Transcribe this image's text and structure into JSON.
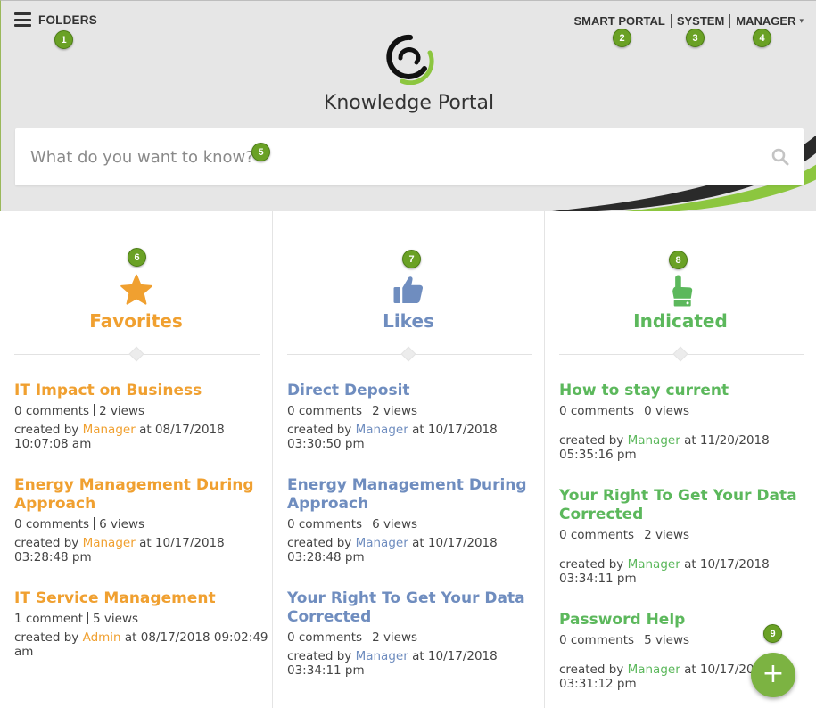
{
  "header": {
    "folders_label": "FOLDERS",
    "nav": [
      "SMART PORTAL",
      "SYSTEM",
      "MANAGER"
    ],
    "manager_caret": "▾",
    "title": "Knowledge Portal"
  },
  "search": {
    "placeholder": "What do you want to know?",
    "icon": "search-icon"
  },
  "badges": [
    "1",
    "2",
    "3",
    "4",
    "5",
    "6",
    "7",
    "8",
    "9"
  ],
  "colors": {
    "favorites": "#f0a030",
    "likes": "#6f8dbf",
    "indicated": "#5cb85c",
    "badge": "#6aa125",
    "fab": "#7cb342"
  },
  "favorites": {
    "title": "Favorites",
    "icon": "star-icon",
    "articles": [
      {
        "title": "IT Impact on Business",
        "comments": "0 comments",
        "views": "2 views",
        "created_prefix": "created by",
        "user": "Manager",
        "date_line1": "at 08/17/2018",
        "date_line2": "10:07:08 am"
      },
      {
        "title_line1": "Energy Management During",
        "title_line2": "Approach",
        "comments": "0 comments",
        "views": "6 views",
        "created_prefix": "created by",
        "user": "Manager",
        "date_line1": "at 10/17/2018",
        "date_line2": "03:28:48 pm"
      },
      {
        "title": "IT Service Management",
        "comments": "1 comment",
        "views": "5 views",
        "created_prefix": "created by",
        "user": "Admin",
        "date_line1": "at 08/17/2018 09:02:49",
        "date_line2": "am"
      }
    ]
  },
  "likes": {
    "title": "Likes",
    "icon": "thumbs-up-icon",
    "articles": [
      {
        "title": "Direct Deposit",
        "comments": "0 comments",
        "views": "2 views",
        "created_prefix": "created by",
        "user": "Manager",
        "date_line1": "at 10/17/2018",
        "date_line2": "03:30:50 pm"
      },
      {
        "title_line1": "Energy Management During",
        "title_line2": "Approach",
        "comments": "0 comments",
        "views": "6 views",
        "created_prefix": "created by",
        "user": "Manager",
        "date_line1": "at 10/17/2018",
        "date_line2": "03:28:48 pm"
      },
      {
        "title_line1": "Your Right To Get Your Data",
        "title_line2": "Corrected",
        "comments": "0 comments",
        "views": "2 views",
        "created_prefix": "created by",
        "user": "Manager",
        "date_line1": "at 10/17/2018",
        "date_line2": "03:34:11 pm"
      }
    ]
  },
  "indicated": {
    "title": "Indicated",
    "icon": "pointing-hand-icon",
    "articles": [
      {
        "title": "How to stay current",
        "comments": "0 comments",
        "views": "0 views",
        "created_prefix": "created by",
        "user": "Manager",
        "date_line1": "at 11/20/2018",
        "date_line2": "05:35:16 pm"
      },
      {
        "title_line1": "Your Right To Get Your Data",
        "title_line2": "Corrected",
        "comments": "0 comments",
        "views": "2 views",
        "created_prefix": "created by",
        "user": "Manager",
        "date_line1": "at 10/17/2018",
        "date_line2": "03:34:11 pm"
      },
      {
        "title": "Password Help",
        "comments": "0 comments",
        "views": "5 views",
        "created_prefix": "created by",
        "user": "Manager",
        "date_line1": "at 10/17/20",
        "date_line2": "03:31:12 pm"
      }
    ]
  },
  "fab": {
    "label": "+"
  }
}
